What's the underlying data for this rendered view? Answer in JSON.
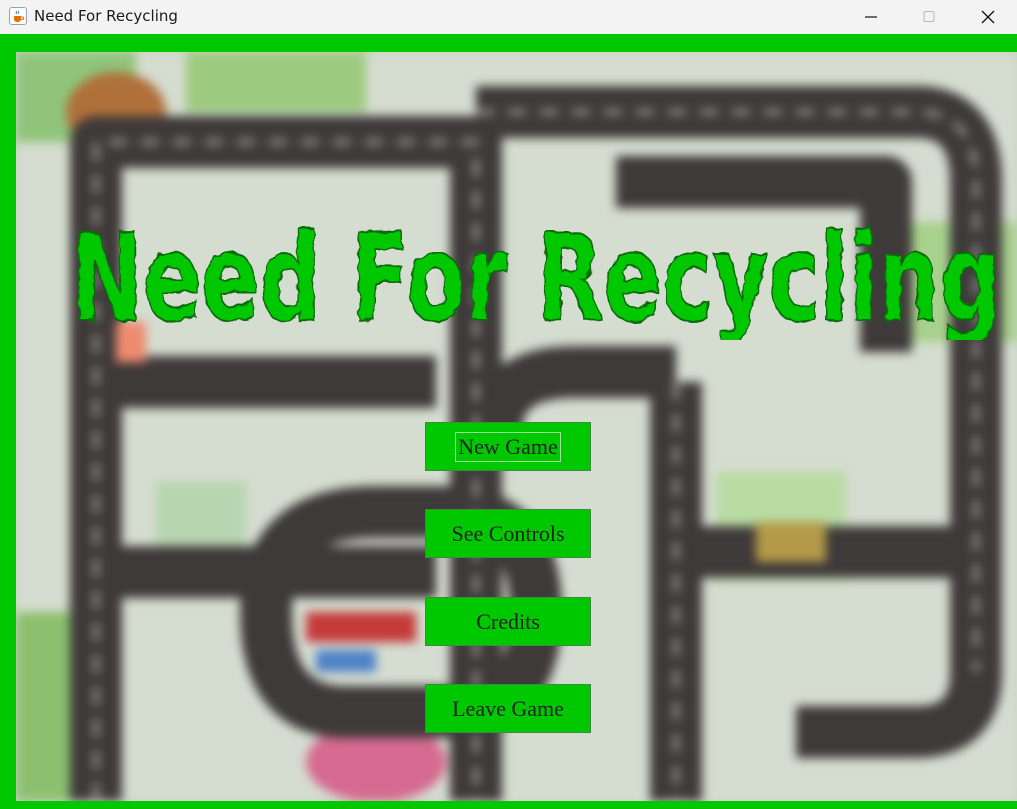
{
  "window": {
    "title": "Need For Recycling",
    "icon": "java-cup-icon",
    "controls": [
      "minimize-icon",
      "maximize-icon",
      "close-icon"
    ]
  },
  "game": {
    "logo_text": "Need For Recycling",
    "background": "blurred-city-road-map",
    "accent_color": "#00c800",
    "menu": [
      {
        "label": "New Game",
        "focused": true
      },
      {
        "label": "See Controls",
        "focused": false
      },
      {
        "label": "Credits",
        "focused": false
      },
      {
        "label": "Leave Game",
        "focused": false
      }
    ]
  }
}
